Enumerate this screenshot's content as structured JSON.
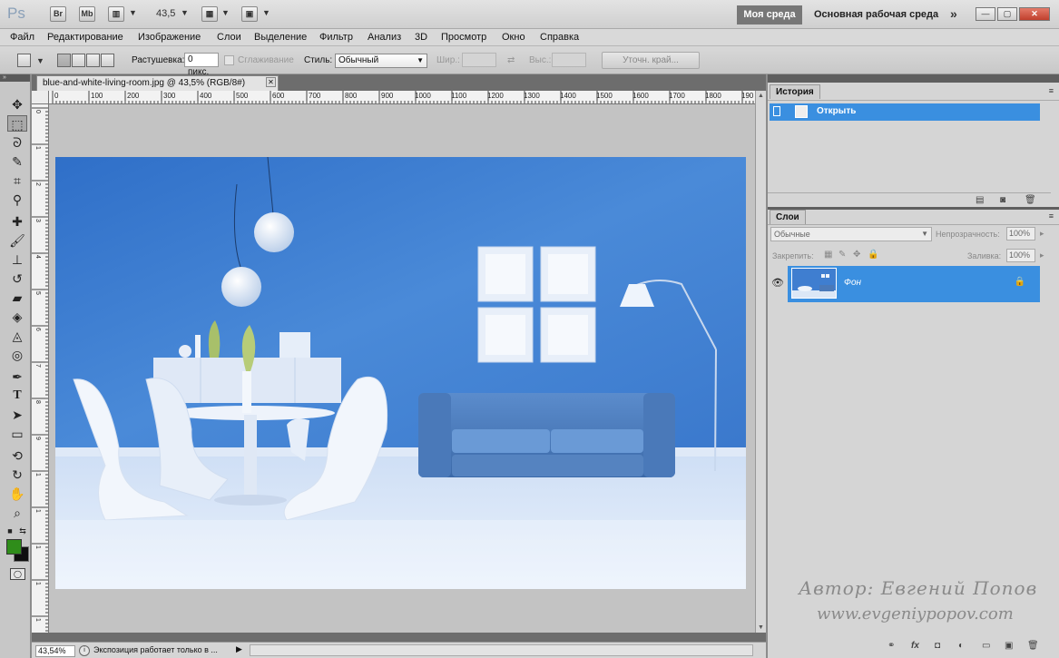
{
  "app": {
    "logo": "Ps",
    "bridge_btn": "Br",
    "minibridge_btn": "Mb",
    "zoom_value": "43,5",
    "workspace_active": "Моя среда",
    "workspace_other": "Основная рабочая среда",
    "more": "»"
  },
  "menu": [
    "Файл",
    "Редактирование",
    "Изображение",
    "Слои",
    "Выделение",
    "Фильтр",
    "Анализ",
    "3D",
    "Просмотр",
    "Окно",
    "Справка"
  ],
  "options": {
    "feather_label": "Растушевка:",
    "feather_value": "0 пикс.",
    "antialias_label": "Сглаживание",
    "style_label": "Стиль:",
    "style_value": "Обычный",
    "width_label": "Шир.:",
    "height_label": "Выс.:",
    "refine_btn": "Уточн. край..."
  },
  "document": {
    "tab_title": "blue-and-white-living-room.jpg @ 43,5% (RGB/8#)",
    "ruler_h": [
      "0",
      "100",
      "200",
      "300",
      "400",
      "500",
      "600",
      "700",
      "800",
      "900",
      "1000",
      "1100",
      "1200",
      "1300",
      "1400",
      "1500",
      "1600",
      "1700",
      "1800",
      "190"
    ],
    "ruler_v": [
      "0",
      "1",
      "2",
      "3",
      "4",
      "5",
      "6",
      "7",
      "8",
      "9",
      "1",
      "1",
      "1",
      "1",
      "1"
    ],
    "status_zoom": "43,54%",
    "status_text": "Экспозиция работает только в ..."
  },
  "history": {
    "tab": "История",
    "items": [
      {
        "name": "Открыть"
      }
    ]
  },
  "layers": {
    "tab": "Слои",
    "blend_mode": "Обычные",
    "opacity_label": "Непрозрачность:",
    "opacity_value": "100%",
    "lock_label": "Закрепить:",
    "fill_label": "Заливка:",
    "fill_value": "100%",
    "items": [
      {
        "name": "Фон"
      }
    ]
  },
  "watermark": {
    "author": "Автор: Евгений Попов",
    "site": "www.evgeniypopov.com"
  },
  "colors": {
    "foreground": "#2f8d1a",
    "background": "#0f0f0f",
    "selection": "#3a8fe0",
    "wall": "#3f7ed0"
  }
}
